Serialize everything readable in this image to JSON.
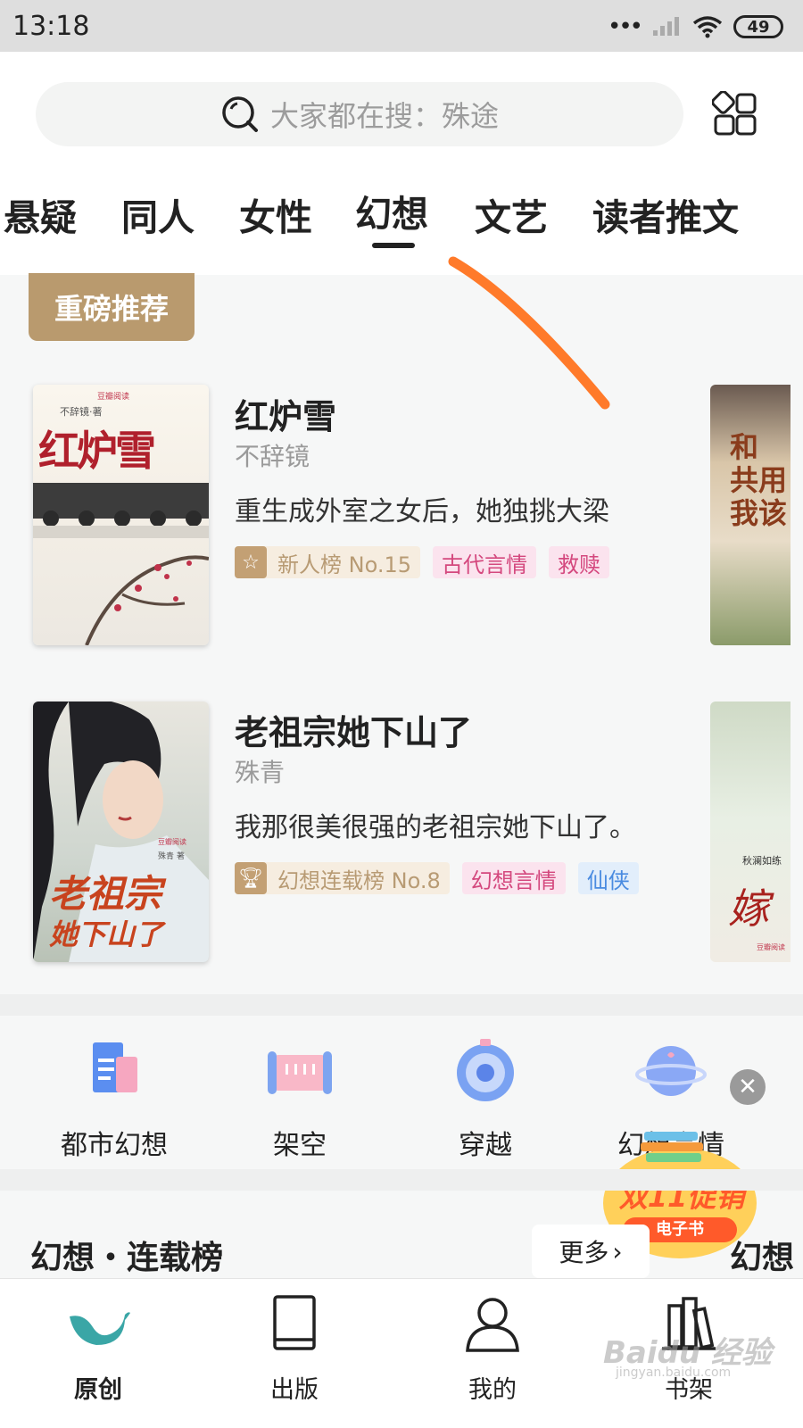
{
  "status_bar": {
    "time": "13:18",
    "dots": "•••",
    "battery": "49"
  },
  "search": {
    "placeholder": "大家都在搜：殊途",
    "icon": "search-icon"
  },
  "tabs": [
    {
      "label": "悬疑"
    },
    {
      "label": "同人"
    },
    {
      "label": "女性"
    },
    {
      "label": "幻想",
      "active": true
    },
    {
      "label": "文艺"
    },
    {
      "label": "读者推文"
    }
  ],
  "section_badge": "重磅推荐",
  "books": [
    {
      "title": "红炉雪",
      "author": "不辞镜",
      "desc": "重生成外室之女后，她独挑大梁",
      "rank_icon": "star-icon",
      "rank": "新人榜 No.15",
      "tags": [
        "古代言情",
        "救赎"
      ],
      "cover": {
        "publisher": "豆瓣阅读",
        "author_line": "不辞镜·著",
        "title": "红炉雪"
      }
    },
    {
      "title": "老祖宗她下山了",
      "author": "殊青",
      "desc": "我那很美很强的老祖宗她下山了。",
      "rank_icon": "trophy-icon",
      "rank": "幻想连载榜 No.8",
      "tags": [
        "幻想言情",
        "仙侠"
      ],
      "cover": {
        "publisher": "豆瓣阅读",
        "author_line": "殊青 著",
        "title": "老祖宗",
        "subtitle": "她下山了"
      }
    }
  ],
  "peek_covers": [
    {
      "text": "和\n共用\n我该"
    },
    {
      "text": "嫁",
      "author_line": "秋澜如练",
      "publisher": "豆瓣阅读"
    }
  ],
  "categories": [
    {
      "label": "都市幻想",
      "icon": "city-book-icon"
    },
    {
      "label": "架空",
      "icon": "scroll-icon"
    },
    {
      "label": "穿越",
      "icon": "portal-icon"
    },
    {
      "label": "幻想言情",
      "icon": "planet-icon"
    }
  ],
  "promo": {
    "title": "双11促销",
    "subtitle": "电子书"
  },
  "rank_section": {
    "title": "幻想・连载榜",
    "more": "更多",
    "peek_title": "幻想"
  },
  "bottom_nav": [
    {
      "label": "原创",
      "icon": "bird-icon",
      "active": true
    },
    {
      "label": "出版",
      "icon": "book-icon"
    },
    {
      "label": "我的",
      "icon": "person-icon"
    },
    {
      "label": "书架",
      "icon": "bookshelf-icon"
    }
  ],
  "watermark": {
    "main": "Baidu 经验",
    "sub": "jingyan.baidu.com"
  },
  "colors": {
    "accent_gold": "#b99a6e",
    "tag_pink": "#d4487e",
    "tag_blue": "#4a8be0",
    "nav_active": "#3aa6a6",
    "annotation": "#ff7a2a"
  }
}
